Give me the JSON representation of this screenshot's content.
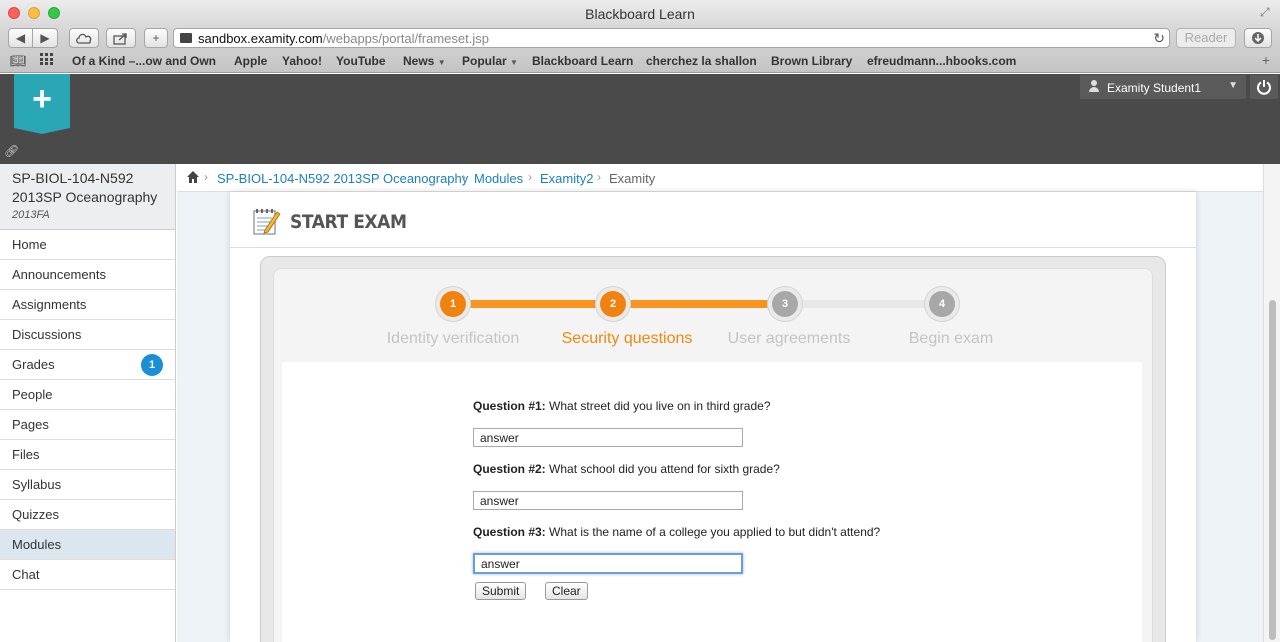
{
  "window": {
    "title": "Blackboard Learn"
  },
  "toolbar": {
    "back": "◀",
    "forward": "▶",
    "new_tab": "+",
    "url_host": "sandbox.examity.com",
    "url_path": "/webapps/portal/frameset.jsp",
    "reader": "Reader"
  },
  "bookmarks": [
    {
      "label": "Of a Kind –...ow and Own",
      "menu": false
    },
    {
      "label": "Apple",
      "menu": false
    },
    {
      "label": "Yahoo!",
      "menu": false
    },
    {
      "label": "YouTube",
      "menu": false
    },
    {
      "label": "News",
      "menu": true
    },
    {
      "label": "Popular",
      "menu": true
    },
    {
      "label": "Blackboard Learn",
      "menu": false
    },
    {
      "label": "cherchez la shallon",
      "menu": false
    },
    {
      "label": "Brown Library",
      "menu": false
    },
    {
      "label": "efreudmann...hbooks.com",
      "menu": false
    }
  ],
  "header": {
    "user_name": "Examity Student1"
  },
  "course": {
    "title": "SP-BIOL-104-N592 2013SP Oceanography",
    "term": "2013FA"
  },
  "nav": [
    {
      "label": "Home"
    },
    {
      "label": "Announcements"
    },
    {
      "label": "Assignments"
    },
    {
      "label": "Discussions"
    },
    {
      "label": "Grades",
      "badge": "1"
    },
    {
      "label": "People"
    },
    {
      "label": "Pages"
    },
    {
      "label": "Files"
    },
    {
      "label": "Syllabus"
    },
    {
      "label": "Quizzes"
    },
    {
      "label": "Modules",
      "active": true
    },
    {
      "label": "Chat"
    }
  ],
  "breadcrumb": [
    "SP-BIOL-104-N592 2013SP Oceanography",
    "Modules",
    "Examity2",
    "Examity"
  ],
  "exam": {
    "title": "START EXAM",
    "steps": [
      {
        "number": "1",
        "label": "Identity verification",
        "state": "done"
      },
      {
        "number": "2",
        "label": "Security questions",
        "state": "current"
      },
      {
        "number": "3",
        "label": "User agreements",
        "state": "todo"
      },
      {
        "number": "4",
        "label": "Begin exam",
        "state": "todo"
      }
    ],
    "questions": [
      {
        "number": "Question #1:",
        "text": "What street did you live on in third grade?",
        "answer": "answer"
      },
      {
        "number": "Question #2:",
        "text": "What school did you attend for sixth grade?",
        "answer": "answer"
      },
      {
        "number": "Question #3:",
        "text": "What is the name of a college you applied to but didn't attend?",
        "answer": "answer"
      }
    ],
    "submit_label": "Submit",
    "clear_label": "Clear"
  },
  "colors": {
    "accent_orange": "#f0820f",
    "link_blue": "#1b7fc2",
    "header_dark": "#4a4a4a",
    "add_tab_teal": "#2aa7b4",
    "badge_blue": "#1b8fd5"
  }
}
